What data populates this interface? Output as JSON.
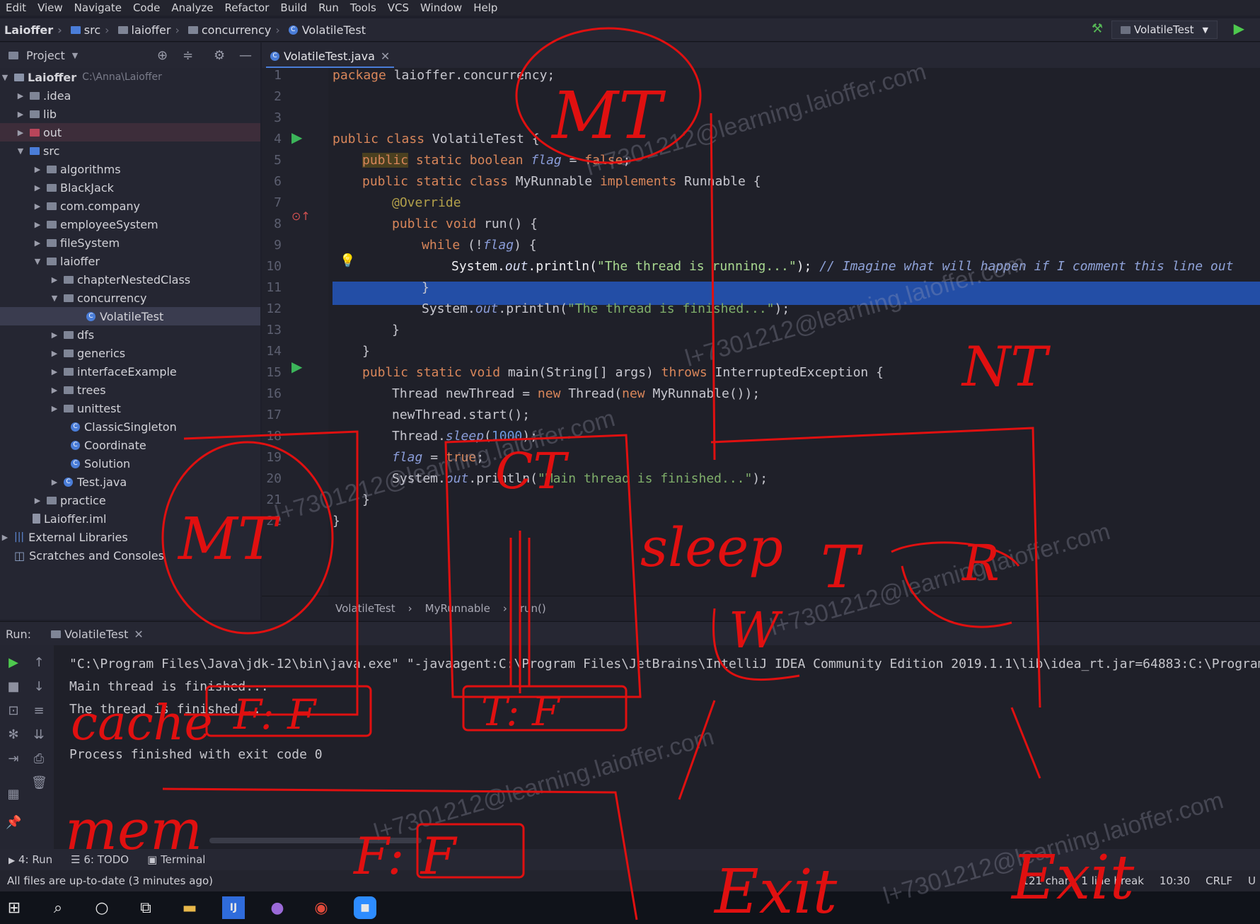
{
  "menu": [
    "Edit",
    "View",
    "Navigate",
    "Code",
    "Analyze",
    "Refactor",
    "Build",
    "Run",
    "Tools",
    "VCS",
    "Window",
    "Help"
  ],
  "nav": {
    "project": "Laioffer",
    "crumbs": [
      "src",
      "laioffer",
      "concurrency",
      "VolatileTest"
    ],
    "run_config": "VolatileTest"
  },
  "project_panel": {
    "title": "Project",
    "root_name": "Laioffer",
    "root_path": "C:\\Anna\\Laioffer",
    "items": [
      ".idea",
      "lib",
      "out",
      "src",
      "algorithms",
      "BlackJack",
      "com.company",
      "employeeSystem",
      "fileSystem",
      "laioffer",
      "chapterNestedClass",
      "concurrency",
      "VolatileTest",
      "dfs",
      "generics",
      "interfaceExample",
      "trees",
      "unittest",
      "ClassicSingleton",
      "Coordinate",
      "Solution",
      "Test.java",
      "practice",
      "Laioffer.iml",
      "External Libraries",
      "Scratches and Consoles"
    ]
  },
  "editor": {
    "tab": "VolatileTest.java",
    "line_numbers": [
      "1",
      "2",
      "3",
      "4",
      "5",
      "6",
      "7",
      "8",
      "9",
      "10",
      "11",
      "12",
      "13",
      "14",
      "15",
      "16",
      "17",
      "18",
      "19",
      "20",
      "21",
      "22"
    ],
    "code": {
      "l1_kw": "package",
      "l1": " laioffer.concurrency;",
      "l4_kw": "public class",
      "l4": " VolatileTest {",
      "l5_kw": "public",
      "l5_kw2": " static boolean ",
      "l5_it": "flag",
      "l5": " = ",
      "l5_kw3": "false",
      "l5_end": ";",
      "l6_kw": "public static class",
      "l6": " MyRunnable ",
      "l6_kw2": "implements",
      "l6_end": " Runnable {",
      "l7_ann": "@Override",
      "l8_kw": "public void",
      "l8": " run() {",
      "l9_kw": "while",
      "l9": " (!",
      "l9_it": "flag",
      "l9_end": ") {",
      "l10": "System.",
      "l10_it": "out",
      "l10_b": ".println(",
      "l10_str": "\"The thread is running...\"",
      "l10_end": ");",
      "l10_cm": "// Imagine what will happen if I comment this line out",
      "l11": "}",
      "l12": "System.",
      "l12_it": "out",
      "l12_b": ".println(",
      "l12_str": "\"The thread is finished...\"",
      "l12_end": ");",
      "l13": "}",
      "l14": "}",
      "l15_kw": "public static void",
      "l15": " main(String[] args) ",
      "l15_kw2": "throws",
      "l15_end": " InterruptedException {",
      "l16": "Thread newThread = ",
      "l16_kw": "new",
      "l16_b": " Thread(",
      "l16_kw2": "new",
      "l16_end": " MyRunnable());",
      "l17": "newThread.start();",
      "l18": "Thread.",
      "l18_it": "sleep",
      "l18_b": "(",
      "l18_num": "1000",
      "l18_end": ");",
      "l19_it": "flag",
      "l19": " = ",
      "l19_kw": "true",
      "l19_end": ";",
      "l20": "System.",
      "l20_it": "out",
      "l20_b": ".println(",
      "l20_str": "\"Main thread is finished...\"",
      "l20_end": ");",
      "l21": "}",
      "l22": "}"
    },
    "breadcrumbs": [
      "VolatileTest",
      "MyRunnable",
      "run()"
    ]
  },
  "run_panel": {
    "label": "Run:",
    "tab": "VolatileTest",
    "output": [
      "\"C:\\Program Files\\Java\\jdk-12\\bin\\java.exe\" \"-javaagent:C:\\Program Files\\JetBrains\\IntelliJ IDEA Community Edition 2019.1.1\\lib\\idea_rt.jar=64883:C:\\Program",
      "Main thread is finished...",
      "The thread is finished...",
      "",
      "Process finished with exit code 0"
    ]
  },
  "tool_windows": [
    "4: Run",
    "6: TODO",
    "Terminal"
  ],
  "status": {
    "left": "All files are up-to-date (3 minutes ago)",
    "chars": "121 chars, 1 line break",
    "position": "10:30",
    "line_sep": "CRLF",
    "encoding": "U"
  },
  "annotations": {
    "mt_top": "MT",
    "mt_left": "MT",
    "ct": "CT",
    "nt": "NT",
    "sleep": "sleep",
    "t": "T",
    "r": "R",
    "w": "W",
    "cache": "cache",
    "f_f": "F: F",
    "t_f": "T: F",
    "mem": "mem",
    "mem_f": "F: F",
    "exit1": "Exit",
    "exit2": "Exit"
  },
  "watermark": "l+7301212@learning.laioffer.com",
  "colors": {
    "accent": "#4a7dd8",
    "ink": "#e01010",
    "run_green": "#4ec94e"
  }
}
